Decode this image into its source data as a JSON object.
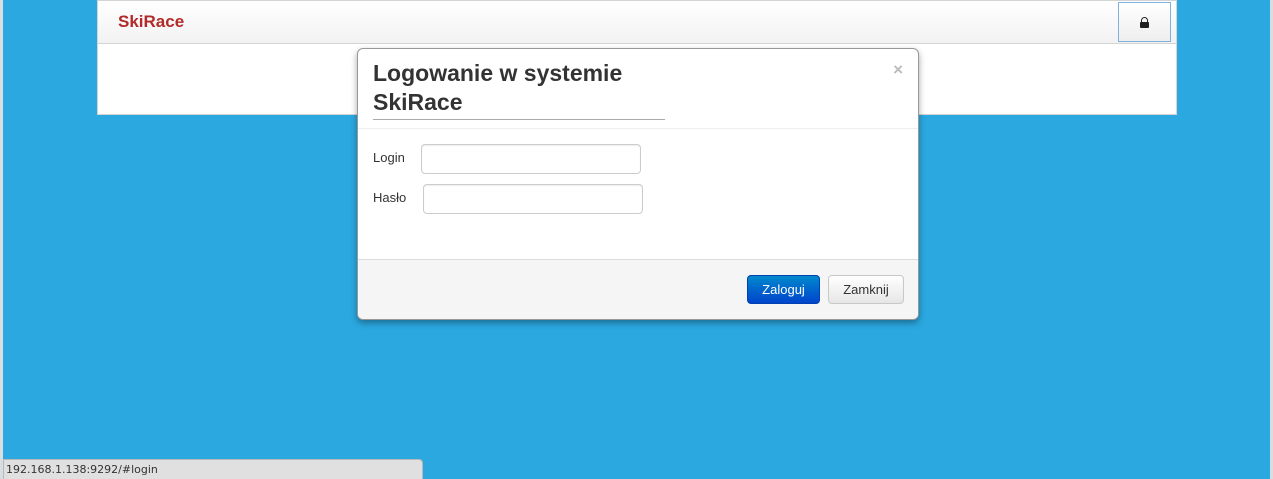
{
  "app": {
    "brand": "SkiRace"
  },
  "navbar": {
    "lock_icon": "lock-icon"
  },
  "modal": {
    "title": "Logowanie w systemie SkiRace",
    "close": "×",
    "fields": {
      "login_label": "Login",
      "login_value": "",
      "password_label": "Hasło",
      "password_value": ""
    },
    "buttons": {
      "submit": "Zaloguj",
      "close": "Zamknij"
    }
  },
  "status_bar": {
    "url": "192.168.1.138:9292/#login"
  },
  "colors": {
    "background": "#2ba8e0",
    "brand": "#b22a2a",
    "primary_button": "#0055cc"
  }
}
